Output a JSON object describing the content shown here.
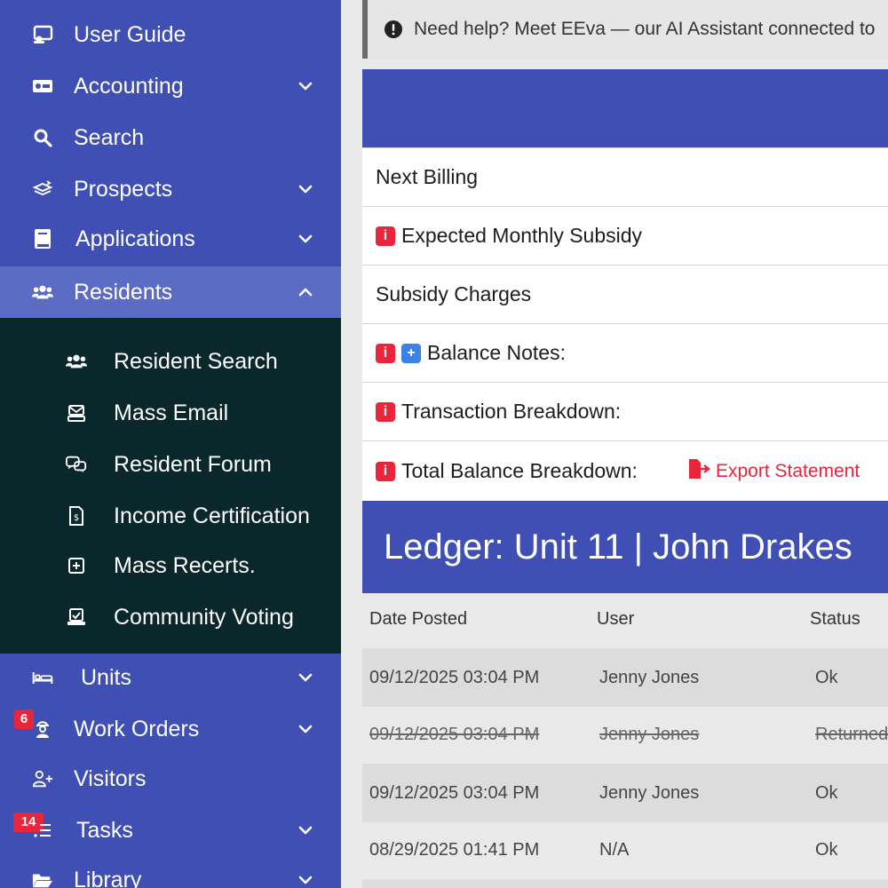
{
  "sidebar": {
    "items": [
      {
        "label": "User Guide"
      },
      {
        "label": "Accounting"
      },
      {
        "label": "Search"
      },
      {
        "label": "Prospects"
      },
      {
        "label": "Applications"
      },
      {
        "label": "Residents"
      },
      {
        "label": "Units"
      },
      {
        "label": "Work Orders",
        "badge": "6"
      },
      {
        "label": "Visitors"
      },
      {
        "label": "Tasks",
        "badge": "14"
      },
      {
        "label": "Library"
      }
    ],
    "submenu": [
      {
        "label": "Resident Search"
      },
      {
        "label": "Mass Email"
      },
      {
        "label": "Resident Forum"
      },
      {
        "label": "Income Certification"
      },
      {
        "label": "Mass Recerts."
      },
      {
        "label": "Community Voting"
      }
    ]
  },
  "help_bar": {
    "text": "Need help? Meet EEva — our AI Assistant connected to"
  },
  "summary_rows": [
    {
      "label": "Next Billing"
    },
    {
      "label": "Expected Monthly Subsidy"
    },
    {
      "label": "Subsidy Charges"
    },
    {
      "label": "Balance Notes:"
    },
    {
      "label": "Transaction Breakdown:"
    },
    {
      "label": "Total Balance Breakdown:"
    }
  ],
  "export_statement": "Export Statement",
  "ledger": {
    "title": "Ledger: Unit 11 | John Drakes",
    "headers": {
      "date": "Date Posted",
      "user": "User",
      "status": "Status"
    },
    "rows": [
      {
        "date": "09/12/2025 03:04 PM",
        "user": "Jenny Jones",
        "status": "Ok"
      },
      {
        "date": "09/12/2025 03:04 PM",
        "user": "Jenny Jones",
        "status": "Returned"
      },
      {
        "date": "09/12/2025 03:04 PM",
        "user": "Jenny Jones",
        "status": "Ok"
      },
      {
        "date": "08/29/2025 01:41 PM",
        "user": "N/A",
        "status": "Ok"
      }
    ]
  },
  "colors": {
    "primary": "#3f4fb3",
    "submenu_bg": "#0a272b",
    "danger": "#e8253b",
    "info": "#3b82e6"
  }
}
